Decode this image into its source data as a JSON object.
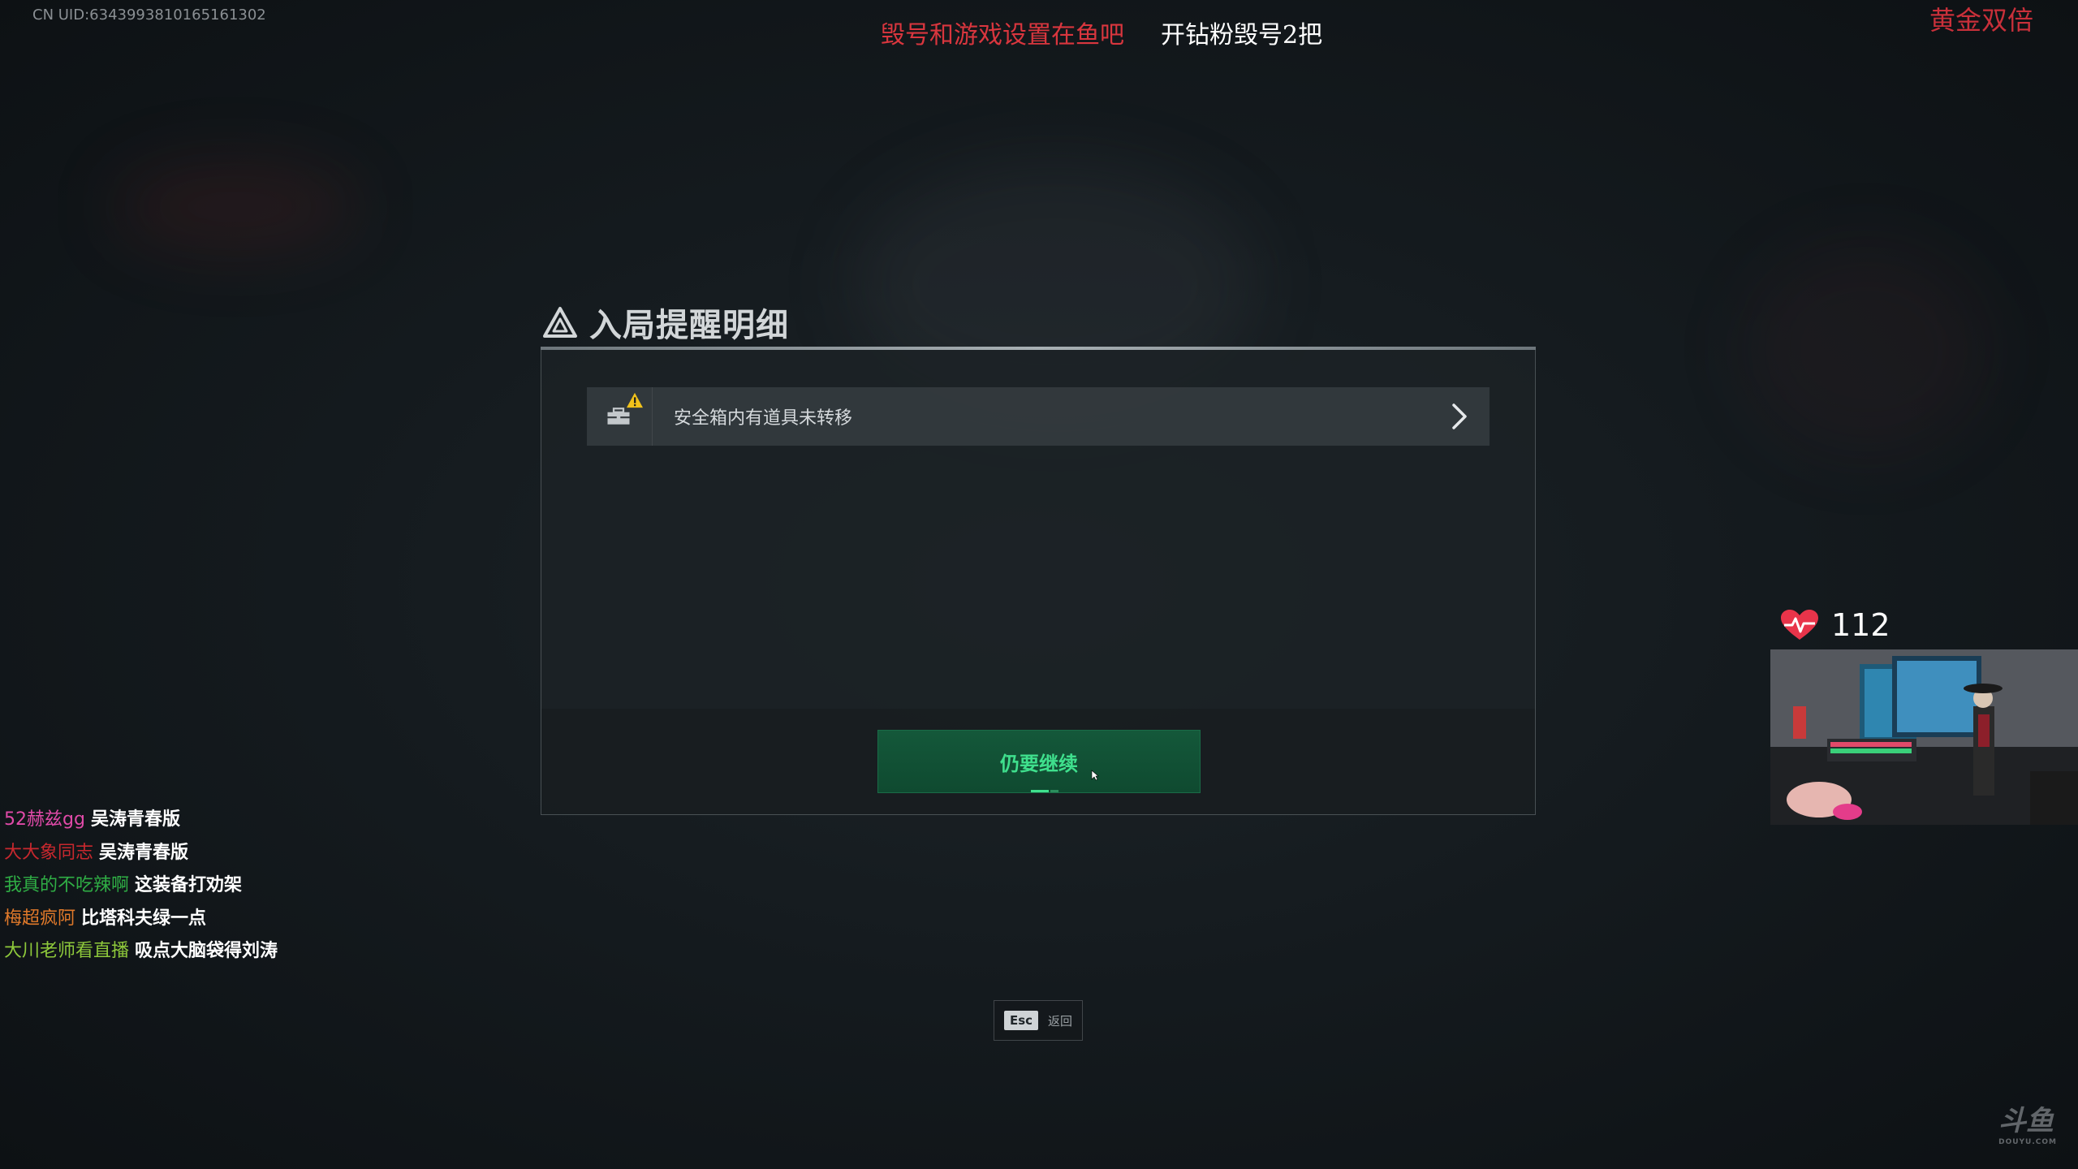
{
  "overlay": {
    "uid": "CN UID:6343993810165161302",
    "banner_red": "毁号和游戏设置在鱼吧",
    "banner_white": "开钻粉毁号2把",
    "top_right": "黄金双倍"
  },
  "dialog": {
    "title": "入局提醒明细",
    "warning_item": "安全箱内有道具未转移",
    "continue_label": "仍要继续"
  },
  "esc": {
    "key": "Esc",
    "label": "返回"
  },
  "chat": [
    {
      "user": "52赫兹gg",
      "user_color": "#e04aa8",
      "msg": "吴涛青春版"
    },
    {
      "user": "大大象同志",
      "user_color": "#c8282e",
      "msg": "吴涛青春版"
    },
    {
      "user": "我真的不吃辣啊",
      "user_color": "#2fae45",
      "msg": "这装备打劝架"
    },
    {
      "user": "梅超疯阿",
      "user_color": "#e0792a",
      "msg": "比塔科夫绿一点"
    },
    {
      "user": "大川老师看直播",
      "user_color": "#8ec93b",
      "msg": "吸点大脑袋得刘涛"
    }
  ],
  "heart_rate": {
    "bpm": "112",
    "color": "#e8344a"
  },
  "watermark": {
    "text": "斗鱼",
    "sub": "DOUYU.COM"
  },
  "colors": {
    "accent_green": "#3fe08d",
    "button_bg": "#0f4a30",
    "warning_yellow": "#f1c21b"
  },
  "icons": {
    "title": "warning-triangle-icon",
    "item": "toolbox-icon",
    "item_badge": "warning-icon",
    "arrow": "chevron-right-icon",
    "heart": "heartbeat-icon"
  }
}
